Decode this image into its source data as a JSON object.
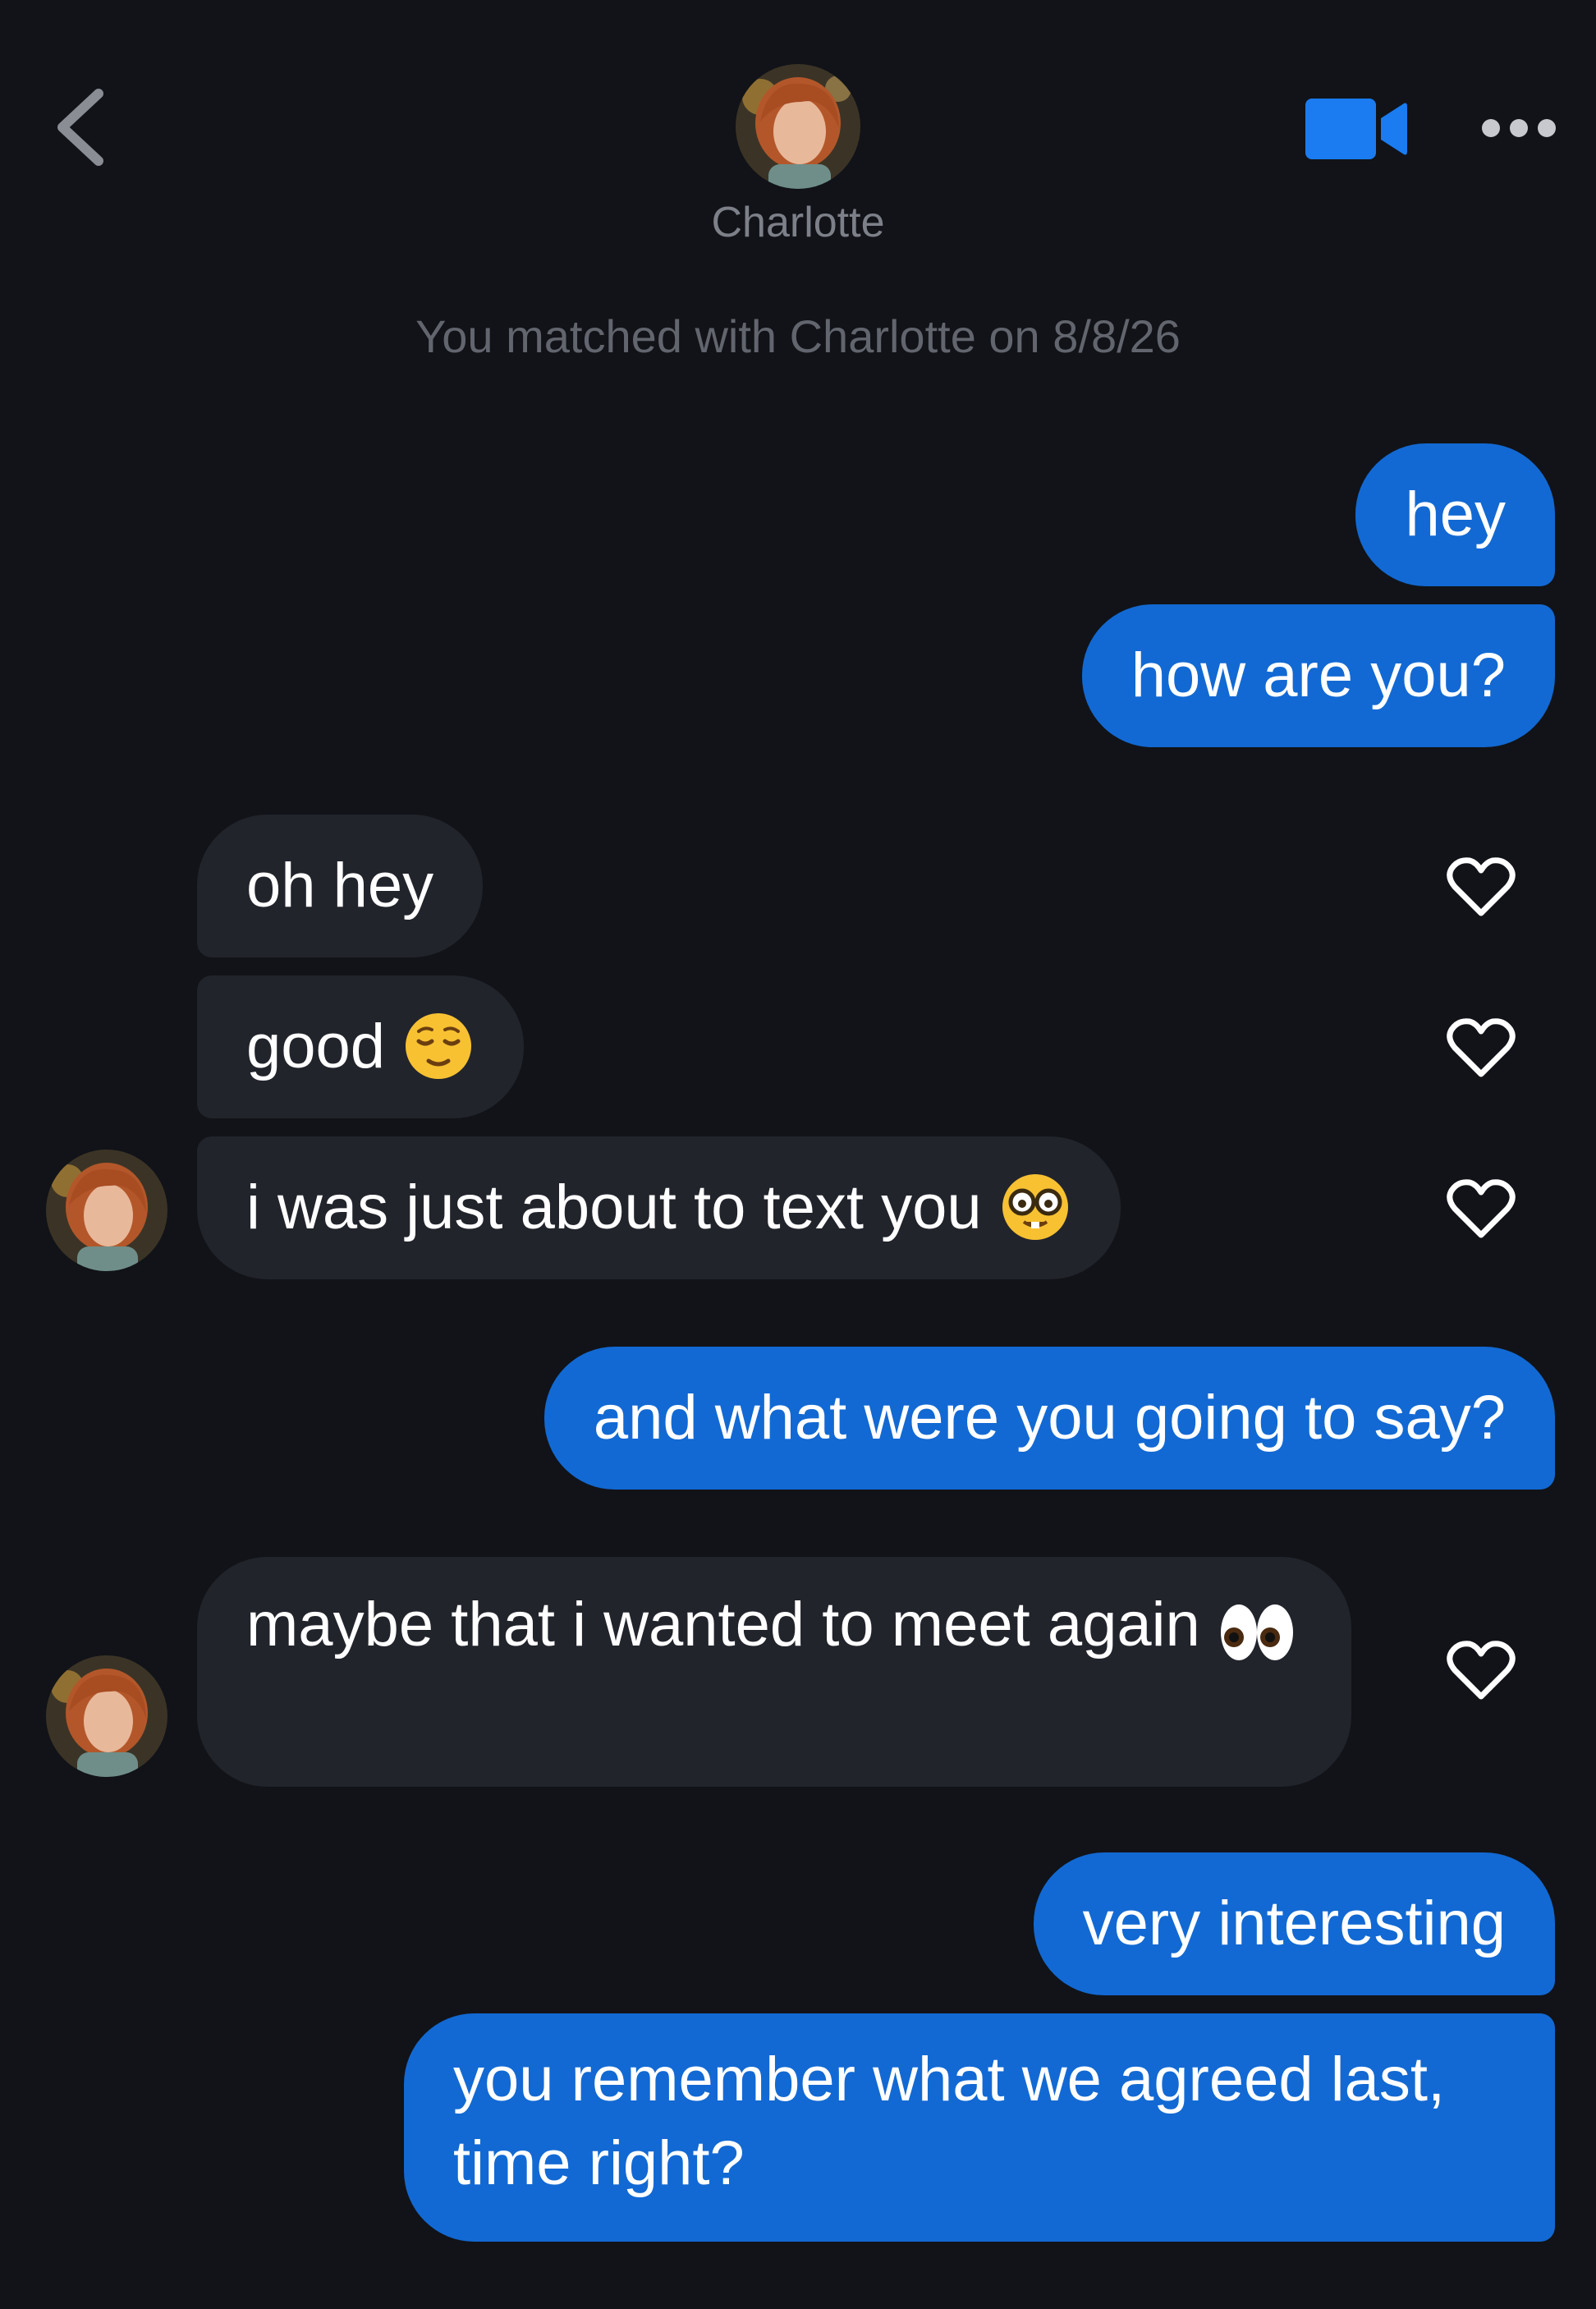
{
  "header": {
    "contact_name": "Charlotte",
    "back_icon": "chevron-left-icon",
    "video_icon": "video-camera-icon",
    "more_icon": "ellipsis-icon"
  },
  "match_note": "You matched with Charlotte on 8/8/26",
  "colors": {
    "background": "#111318",
    "sent_bubble": "#1269d3",
    "received_bubble": "#22242c",
    "accent": "#1a7cf0",
    "muted_text": "#7d8088"
  },
  "messages": [
    {
      "sender": "me",
      "text": "hey"
    },
    {
      "sender": "me",
      "text": "how are you?"
    },
    {
      "sender": "them",
      "text": "oh hey",
      "liked": false
    },
    {
      "sender": "them",
      "text": "good",
      "emoji": "relieved-face-emoji",
      "liked": false
    },
    {
      "sender": "them",
      "text": "i was just about to text you",
      "emoji": "nerd-face-emoji",
      "liked": false
    },
    {
      "sender": "me",
      "text": "and what were you going to say?"
    },
    {
      "sender": "them",
      "text": "maybe that i wanted to meet again",
      "emoji": "eyes-emoji",
      "liked": false
    },
    {
      "sender": "me",
      "text": "very interesting"
    },
    {
      "sender": "me",
      "text": "you remember what we agreed last, time right?"
    }
  ]
}
